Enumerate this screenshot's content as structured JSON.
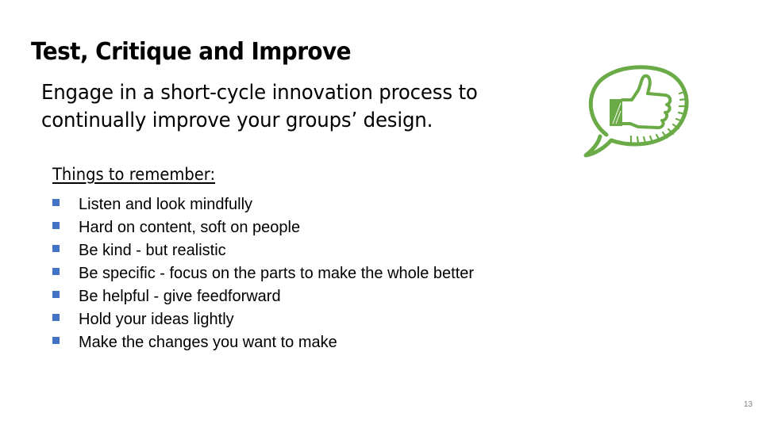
{
  "slide": {
    "title": "Test, Critique and Improve",
    "subtitle_lines": [
      "Engage in a short-cycle innovation process to",
      "continually improve your groups’ design."
    ],
    "remember_heading": "Things to remember:",
    "items": [
      "Listen and look mindfully",
      "Hard on content, soft on people",
      "Be kind - but realistic",
      "Be specific - focus on the parts to make the whole better",
      "Be helpful - give feedforward",
      "Hold your ideas lightly",
      "Make the changes you want to make"
    ],
    "page_number": "13",
    "icon": "thumbs-up-speech-bubble-icon",
    "colors": {
      "accent_green": "#6aab47",
      "bullet_blue": "#4472c4",
      "page_number_gray": "#7f7f7f"
    }
  }
}
